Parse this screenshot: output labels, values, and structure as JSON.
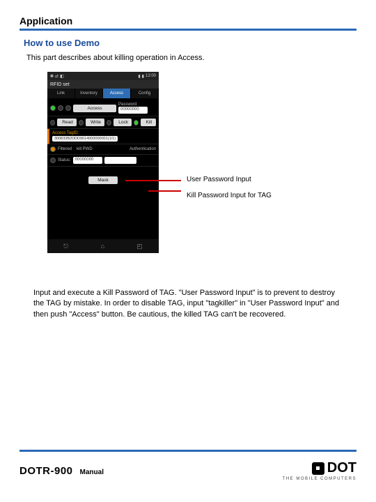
{
  "section": {
    "title": "Application"
  },
  "subsection": {
    "title": "How to use Demo"
  },
  "intro": "This part describes about killing operation in Access.",
  "phone": {
    "app_title": "RFID set",
    "status_icons": [
      "✽",
      "⇄",
      "◧",
      "▮",
      "▮",
      "▮"
    ],
    "clock": "12:00",
    "tabs": [
      "Link",
      "Inventory",
      "Access",
      "Config"
    ],
    "active_tab": 2,
    "access_btn": "Access",
    "password_label": "Password",
    "password_value": "00000000",
    "act_btns": [
      "Read",
      "Write",
      "Lock",
      "Kill"
    ],
    "tagid_label": "Access TagID:",
    "tagid_value": "300833B2DDD9014000000001(1/1)",
    "filter_label": "Filtered",
    "filter_value": "kill PWD",
    "auth_label": "Authentication",
    "status_label": "Status:",
    "status_value": "00000000",
    "kill_value": "",
    "mask_btn": "Mask",
    "nav": [
      "⎋",
      "⌂",
      "◰"
    ]
  },
  "callouts": {
    "user_pw": "User Password Input",
    "kill_pw": "Kill Password Input for TAG"
  },
  "body": "Input and execute a Kill Password of TAG. \"User Password Input\" is to prevent to destroy the TAG by mistake. In order to disable TAG, input \"tagkiller\" in \"User Password Input\" and then push \"Access\" button. Be cautious, the killed TAG can't be recovered.",
  "footer": {
    "product": "DOTR-900",
    "manual": "Manual",
    "brand": "DOT",
    "tagline": "THE MOBILE COMPUTERS"
  }
}
